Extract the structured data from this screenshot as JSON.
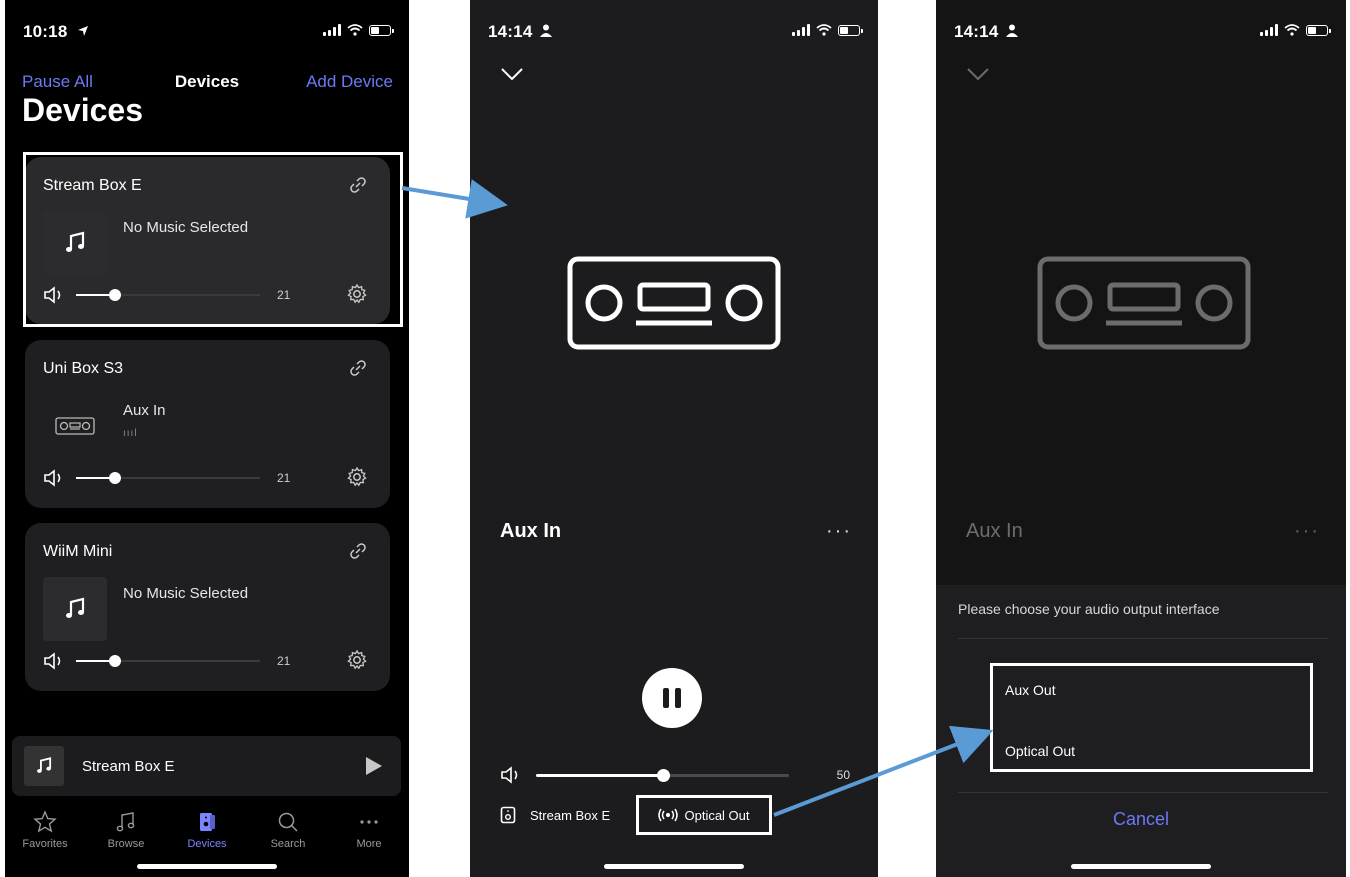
{
  "phone1": {
    "status": {
      "time": "10:18"
    },
    "nav": {
      "left": "Pause All",
      "center": "Devices",
      "right": "Add Device"
    },
    "large_title": "Devices",
    "cards": [
      {
        "name": "Stream Box E",
        "track": "No Music Selected",
        "subtitle": "",
        "volume": 21,
        "volume_label": "21"
      },
      {
        "name": "Uni Box S3",
        "track": "Aux In",
        "subtitle": "ıııl",
        "volume": 21,
        "volume_label": "21"
      },
      {
        "name": "WiiM Mini",
        "track": "No Music Selected",
        "subtitle": "",
        "volume": 21,
        "volume_label": "21"
      }
    ],
    "mini_player": {
      "name": "Stream Box E"
    },
    "tabs": [
      {
        "label": "Favorites",
        "icon": "star-icon"
      },
      {
        "label": "Browse",
        "icon": "music-note-icon"
      },
      {
        "label": "Devices",
        "icon": "speaker-icon",
        "active": true
      },
      {
        "label": "Search",
        "icon": "search-icon"
      },
      {
        "label": "More",
        "icon": "ellipsis-icon"
      }
    ]
  },
  "phone2": {
    "status": {
      "time": "14:14"
    },
    "title": "Aux In",
    "more": "···",
    "volume": 50,
    "volume_label": "50",
    "device": "Stream Box E",
    "output": "Optical Out"
  },
  "phone3": {
    "status": {
      "time": "14:14"
    },
    "title": "Aux In",
    "more": "···",
    "prompt": "Please choose your audio output interface",
    "options": [
      "Aux Out",
      "Optical Out"
    ],
    "selected": "Optical Out",
    "cancel": "Cancel"
  },
  "colors": {
    "accent": "#6b79f5",
    "arrow": "#5b9bd5",
    "highlight": "#ffffff"
  }
}
